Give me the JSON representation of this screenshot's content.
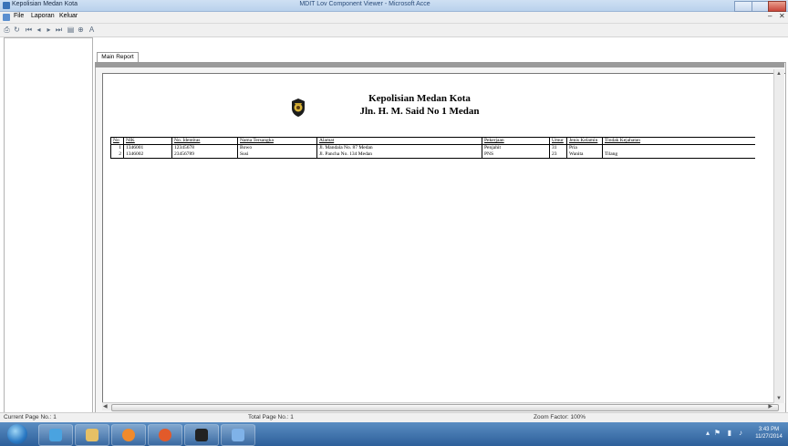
{
  "window": {
    "title": "Kepolisian Medan Kota",
    "center_title": "MDIT Lov Component Viewer - Microsoft Acce"
  },
  "menu": {
    "items": [
      "File",
      "Laporan",
      "Keluar"
    ]
  },
  "tab": {
    "label": "Main Report"
  },
  "report": {
    "title_line1": "Kepolisian Medan Kota",
    "title_line2": "Jln. H. M. Said No 1 Medan",
    "columns": [
      "No",
      "NIK",
      "No. Identitas",
      "Nama Tersangka",
      "Alamat",
      "Pekerjaan",
      "Umur",
      "Jenis Kelamin",
      "Tindak Kejahatan"
    ],
    "rows": [
      [
        "1",
        "1346001",
        "12345678",
        "Bowo",
        "Jl. Mandala No. 87 Medan",
        "Penjahit",
        "31",
        "Pria",
        ""
      ],
      [
        "2",
        "1346002",
        "23456789",
        "Susi",
        "Jl. Pancha No. 134 Medan",
        "PNS",
        "23",
        "Wanita",
        "Tilang"
      ]
    ]
  },
  "status": {
    "current_page": "Current Page No.: 1",
    "total_page": "Total Page No.: 1",
    "zoom": "Zoom Factor: 100%"
  },
  "tray": {
    "time": "3:43 PM",
    "date": "11/27/2014"
  },
  "icons": {
    "app": "report-app-icon",
    "toolbar": [
      "print-icon",
      "refresh-icon",
      "first-page-icon",
      "prev-page-icon",
      "next-page-icon",
      "last-page-icon",
      "export-icon",
      "zoom-icon",
      "search-text-icon"
    ],
    "taskbar": [
      "start-icon",
      "ie-icon",
      "explorer-icon",
      "media-player-icon",
      "firefox-icon",
      "app-user-icon",
      "vb-icon"
    ]
  }
}
